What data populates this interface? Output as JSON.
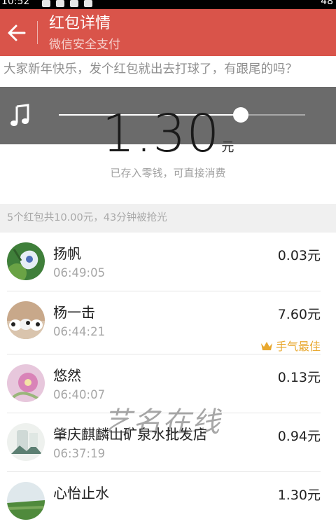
{
  "status_bar": {
    "time": "10:52",
    "right_text": "48"
  },
  "header": {
    "title": "红包详情",
    "subtitle": "微信安全支付"
  },
  "greeting": "大家新年快乐，发个红包就出去打球了，有跟尾的吗？",
  "music_player": {
    "progress": 0.74,
    "icon": "music-note-icon"
  },
  "amount": {
    "value": "1.30",
    "unit": "元"
  },
  "notice": "已存入零钱，可直接消费",
  "summary": "5个红包共10.00元，43分钟被抢光",
  "list": [
    {
      "name": "扬帆",
      "time": "06:49:05",
      "amount": "0.03元",
      "best": ""
    },
    {
      "name": "杨一击",
      "time": "06:44:21",
      "amount": "7.60元",
      "best": "手气最佳"
    },
    {
      "name": "悠然",
      "time": "06:40:07",
      "amount": "0.13元",
      "best": ""
    },
    {
      "name": "肇庆麒麟山矿泉水批发店",
      "time": "06:37:19",
      "amount": "0.94元",
      "best": ""
    },
    {
      "name": "心怡止水",
      "time": "",
      "amount": "1.30元",
      "best": ""
    }
  ],
  "watermark": "艺名在线",
  "colors": {
    "header_bg": "#d9544a",
    "best_color": "#e8a82f",
    "music_bar": "#6b6b6b"
  }
}
